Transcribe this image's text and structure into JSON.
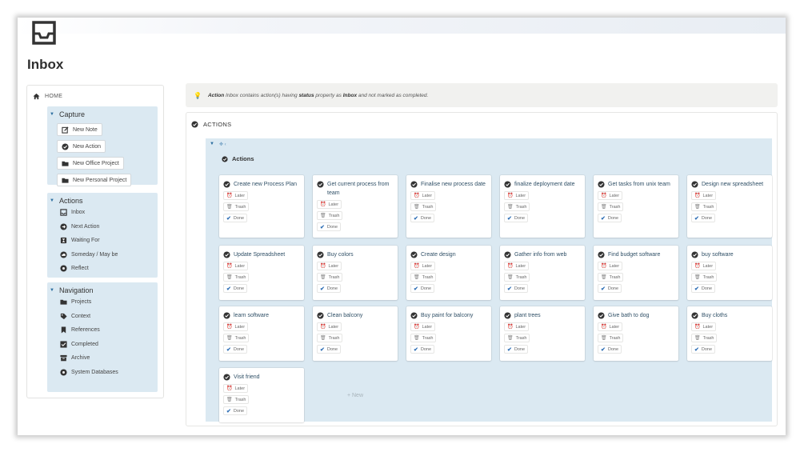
{
  "page": {
    "title": "Inbox",
    "icon": "inbox-tray-icon"
  },
  "sidebar": {
    "home_label": "HOME",
    "sections": [
      {
        "title": "Capture",
        "items": [
          {
            "label": "New Note",
            "icon": "note-edit-icon"
          },
          {
            "label": "New Action",
            "icon": "check-circle-icon"
          },
          {
            "label": "New Office Project",
            "icon": "folder-icon"
          },
          {
            "label": "New Personal Project",
            "icon": "folder-icon"
          }
        ]
      },
      {
        "title": "Actions",
        "items": [
          {
            "label": "Inbox",
            "icon": "inbox-icon"
          },
          {
            "label": "Next Action",
            "icon": "arrow-circle-icon"
          },
          {
            "label": "Waiting For",
            "icon": "hourglass-icon"
          },
          {
            "label": "Someday / May be",
            "icon": "cloud-icon"
          },
          {
            "label": "Reflect",
            "icon": "gear-icon"
          }
        ]
      },
      {
        "title": "Navigation",
        "items": [
          {
            "label": "Projects",
            "icon": "folder-icon"
          },
          {
            "label": "Context",
            "icon": "tag-icon"
          },
          {
            "label": "References",
            "icon": "bookmark-icon"
          },
          {
            "label": "Completed",
            "icon": "checkbox-icon"
          },
          {
            "label": "Archive",
            "icon": "archive-icon"
          },
          {
            "label": "System Databases",
            "icon": "gear-icon"
          }
        ]
      }
    ]
  },
  "callout": {
    "icon": "lightbulb-icon",
    "lead": "Action",
    "text_1": "Inbox contains action(s) having",
    "bold": "status",
    "text_2": "property as",
    "value": "Inbox",
    "text_3": "and not marked as completed."
  },
  "actions": {
    "header": "ACTIONS",
    "group_label": "Actions",
    "tag_labels": {
      "later": "Later",
      "trash": "Trash",
      "done": "Done"
    },
    "new_label": "+ New",
    "cards": [
      "Create new Process Plan",
      "Get current process from team",
      "Finalise new process date",
      "finalize deployment date",
      "Get tasks from unix team",
      "Design new spreadsheet",
      "Update Spreadsheet",
      "Buy colors",
      "Create design",
      "Gather info from web",
      "Find budget software",
      "buy software",
      "learn software",
      "Clean balcony",
      "Buy paint for balcony",
      "plant trees",
      "Give bath to dog",
      "Buy cloths",
      "Visit friend"
    ]
  },
  "colors": {
    "accent_blue": "#2c6ea0",
    "panel_blue": "#dbe9f2",
    "later_red": "#e0533d",
    "done_blue": "#2f6fb5"
  }
}
